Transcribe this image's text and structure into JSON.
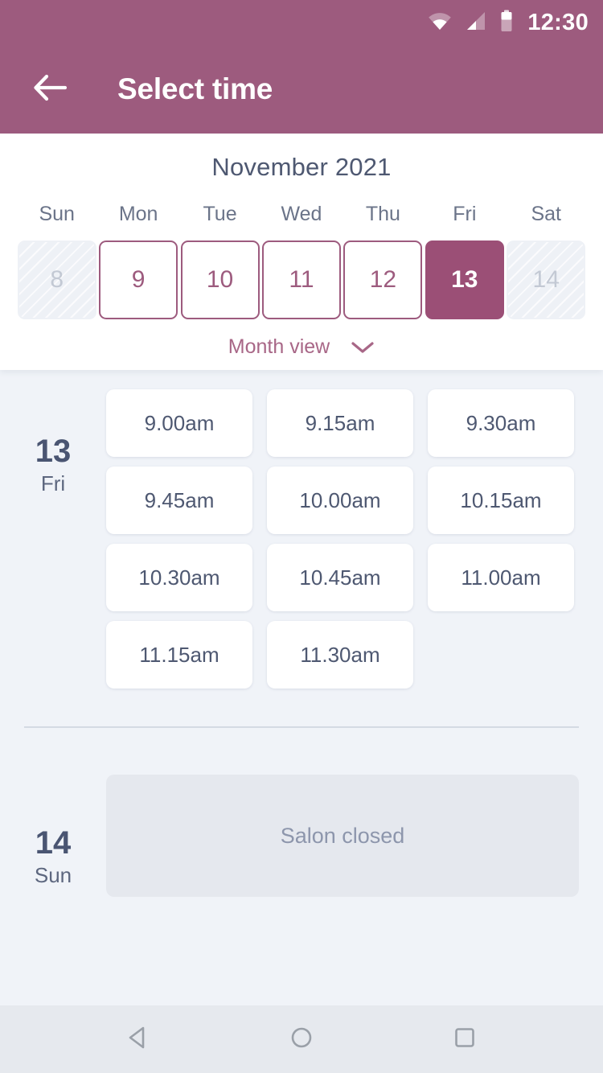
{
  "status_bar": {
    "time": "12:30",
    "icons": [
      "wifi-icon",
      "cell-signal-icon",
      "battery-icon"
    ]
  },
  "app_bar": {
    "back_icon": "arrow-left-icon",
    "title": "Select time"
  },
  "calendar": {
    "month_title": "November 2021",
    "weekdays": [
      "Sun",
      "Mon",
      "Tue",
      "Wed",
      "Thu",
      "Fri",
      "Sat"
    ],
    "days": [
      {
        "num": "8",
        "state": "disabled"
      },
      {
        "num": "9",
        "state": "available"
      },
      {
        "num": "10",
        "state": "available"
      },
      {
        "num": "11",
        "state": "available"
      },
      {
        "num": "12",
        "state": "available"
      },
      {
        "num": "13",
        "state": "selected"
      },
      {
        "num": "14",
        "state": "disabled"
      }
    ],
    "month_view_label": "Month view",
    "chevron_icon": "chevron-down-icon"
  },
  "schedule": {
    "days": [
      {
        "day_num": "13",
        "day_of_week": "Fri",
        "slots": [
          "9.00am",
          "9.15am",
          "9.30am",
          "9.45am",
          "10.00am",
          "10.15am",
          "10.30am",
          "10.45am",
          "11.00am",
          "11.15am",
          "11.30am"
        ]
      },
      {
        "day_num": "14",
        "day_of_week": "Sun",
        "closed_message": "Salon closed"
      }
    ]
  },
  "nav_bar": {
    "back_icon": "nav-back-triangle-icon",
    "home_icon": "nav-home-circle-icon",
    "recents_icon": "nav-recents-square-icon"
  },
  "colors": {
    "header": "#9d5b7e",
    "selected_day": "#9b4f76",
    "accent_text": "#a86787",
    "page_bg": "#f0f3f8",
    "slot_text": "#4e5871"
  }
}
